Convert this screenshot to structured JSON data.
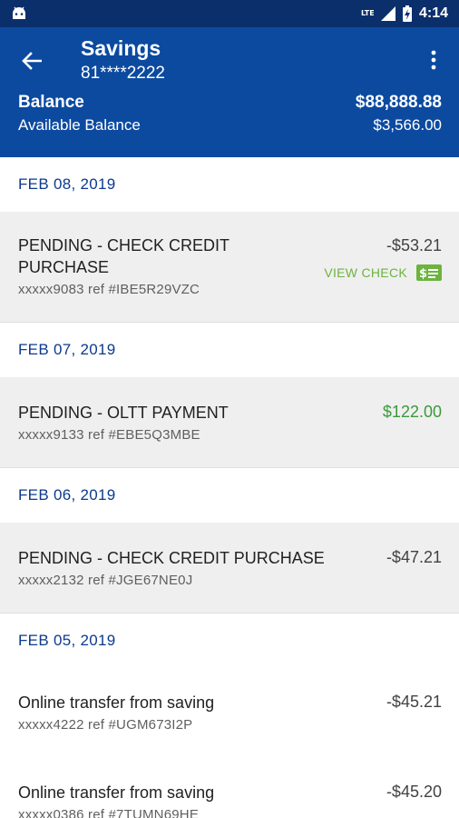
{
  "status_bar": {
    "time": "4:14",
    "network": "LTE",
    "icons": [
      "android-robot-icon",
      "lte-icon",
      "signal-icon",
      "battery-charging-icon"
    ]
  },
  "header": {
    "title": "Savings",
    "account_number": "81****2222",
    "balance_label": "Balance",
    "balance_value": "$88,888.88",
    "available_label": "Available Balance",
    "available_value": "$3,566.00",
    "back_icon": "arrow-left-icon",
    "menu_icon": "more-vert-icon",
    "color": "#0c4aa0"
  },
  "groups": [
    {
      "date": "FEB 08, 2019",
      "transactions": [
        {
          "description": "PENDING - CHECK CREDIT PURCHASE",
          "reference": "xxxxx9083 ref #IBE5R29VZC",
          "amount": "-$53.21",
          "view_check_label": "VIEW CHECK"
        }
      ]
    },
    {
      "date": "FEB 07, 2019",
      "transactions": [
        {
          "description": "PENDING - OLTT PAYMENT",
          "reference": "xxxxx9133 ref #EBE5Q3MBE",
          "amount": "$122.00"
        }
      ]
    },
    {
      "date": "FEB 06, 2019",
      "transactions": [
        {
          "description": "PENDING - CHECK CREDIT PURCHASE",
          "reference": "xxxxx2132 ref #JGE67NE0J",
          "amount": "-$47.21"
        }
      ]
    },
    {
      "date": "FEB 05, 2019",
      "transactions": [
        {
          "description": "Online transfer from saving",
          "reference": "xxxxx4222 ref #UGM673I2P",
          "amount": "-$45.21"
        },
        {
          "description": "Online transfer from saving",
          "reference": "xxxxx0386 ref #7TUMN69HE",
          "amount": "-$45.20"
        }
      ]
    }
  ],
  "colors": {
    "date_header": "#0c3a8c",
    "positive_amount": "#3a9a3a",
    "view_check": "#6db33f",
    "pending_row_bg": "#efefef"
  }
}
